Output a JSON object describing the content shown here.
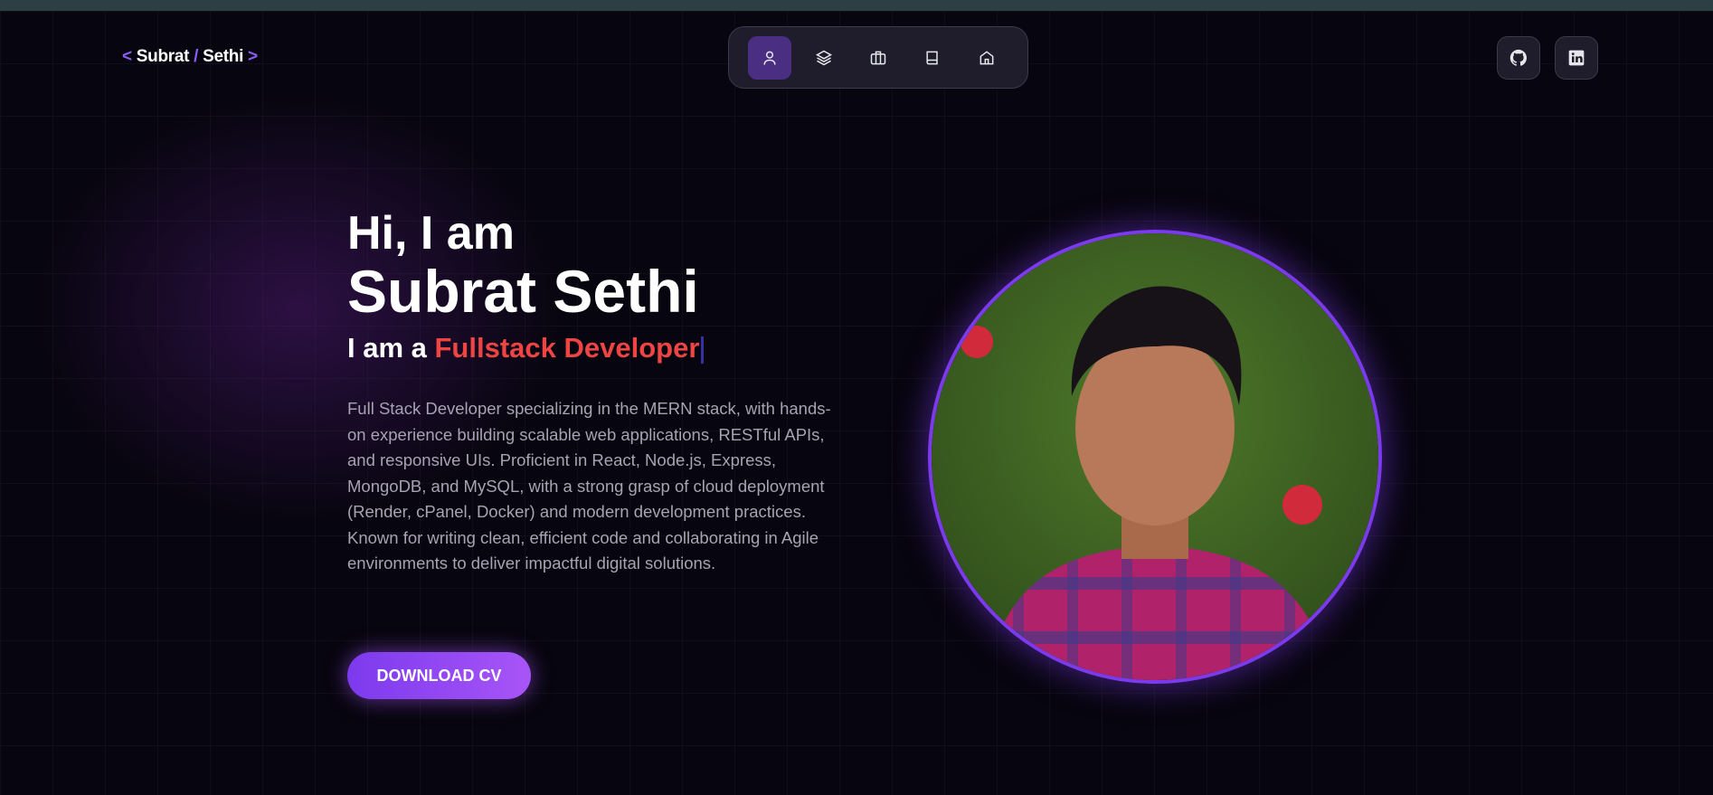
{
  "logo": {
    "first": "Subrat",
    "sep": "/",
    "last": "Sethi",
    "open": "<",
    "close": ">"
  },
  "nav": [
    {
      "icon": "user-icon",
      "label": "About"
    },
    {
      "icon": "layers-icon",
      "label": "Skills"
    },
    {
      "icon": "briefcase-icon",
      "label": "Experience"
    },
    {
      "icon": "book-icon",
      "label": "Education"
    },
    {
      "icon": "home-icon",
      "label": "Home"
    }
  ],
  "social": [
    {
      "icon": "github-icon"
    },
    {
      "icon": "linkedin-icon"
    }
  ],
  "hero": {
    "greeting": "Hi, I am",
    "name": "Subrat Sethi",
    "role_prefix": "I am a ",
    "role": "Fullstack Developer",
    "description": "Full Stack Developer specializing in the MERN stack, with hands-on experience building scalable web applications, RESTful APIs, and responsive UIs. Proficient in React, Node.js, Express, MongoDB, and MySQL, with a strong grasp of cloud deployment (Render, cPanel, Docker) and modern development practices. Known for writing clean, efficient code and collaborating in Agile environments to deliver impactful digital solutions.",
    "cta": "DOWNLOAD CV"
  },
  "colors": {
    "accent": "#7c3aed",
    "role": "#ef4444",
    "bg": "#07050f"
  }
}
